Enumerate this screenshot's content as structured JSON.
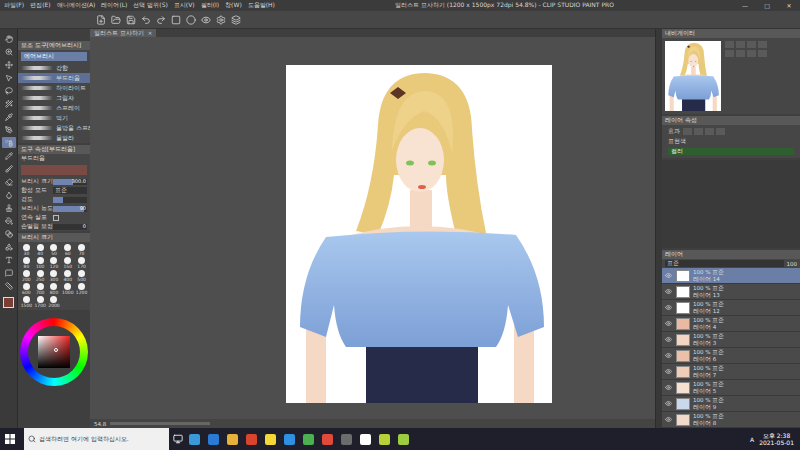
{
  "window": {
    "title": "일러스트 묘사하기 (1200 x 1500px 72dpi 54.8%) - CLIP STUDIO PAINT PRO",
    "menu": [
      "파일(F)",
      "편집(E)",
      "애니메이션(A)",
      "레이어(L)",
      "선택 범위(S)",
      "표시(V)",
      "필터(I)",
      "창(W)",
      "도움말(H)"
    ],
    "controls": [
      "—",
      "□",
      "✕"
    ]
  },
  "document_tab": {
    "label": "일러스트 묘사하기",
    "close": "×"
  },
  "tools": [
    {
      "selected": false
    },
    {
      "selected": false
    },
    {
      "selected": false
    },
    {
      "selected": false
    },
    {
      "selected": false
    },
    {
      "selected": false
    },
    {
      "selected": false
    },
    {
      "selected": false
    },
    {
      "selected": true
    },
    {
      "selected": false
    },
    {
      "selected": false
    },
    {
      "selected": false
    },
    {
      "selected": false
    },
    {
      "selected": false
    },
    {
      "selected": false
    },
    {
      "selected": false
    },
    {
      "selected": false
    },
    {
      "selected": false
    },
    {
      "selected": false
    },
    {
      "selected": false
    }
  ],
  "current_color": "#7b3d34",
  "sub_tool": {
    "title": "보조 도구[에어브러시]",
    "tab": "에어브러시",
    "items": [
      {
        "label": "강함",
        "selected": false
      },
      {
        "label": "부드러움",
        "selected": true
      },
      {
        "label": "하이라이트",
        "selected": false
      },
      {
        "label": "그림자",
        "selected": false
      },
      {
        "label": "스프레이",
        "selected": false
      },
      {
        "label": "먹기",
        "selected": false
      },
      {
        "label": "물방울 스프레이",
        "selected": false
      },
      {
        "label": "물알라",
        "selected": false
      }
    ]
  },
  "tool_property": {
    "title": "도구 속성[부드러움]",
    "tool": "부드러움",
    "rows": [
      {
        "kind": "slider",
        "label": "브러시 크기",
        "value": "300.0",
        "level": 0.6
      },
      {
        "kind": "select",
        "label": "합성 모드",
        "value": "표준"
      },
      {
        "kind": "slider",
        "label": "경도",
        "level": 0.3
      },
      {
        "kind": "slider",
        "label": "브러시 농도",
        "value": "90",
        "level": 0.9
      },
      {
        "kind": "checkbox",
        "label": "연속 살포",
        "checked": false
      },
      {
        "kind": "slider",
        "label": "손떨림 보정",
        "value": "0",
        "level": 0
      }
    ]
  },
  "brush_size": {
    "title": "브러시 크기",
    "sizes": [
      "30",
      "40",
      "50",
      "60",
      "70",
      "80",
      "100",
      "120",
      "150",
      "170",
      "200",
      "250",
      "300",
      "400",
      "500",
      "600",
      "700",
      "800",
      "1000",
      "1200",
      "1500",
      "1700",
      "2000"
    ]
  },
  "color_wheel": {
    "saturation": 0.55,
    "brightness": 0.55
  },
  "canvas_status": {
    "zoom": "54.8"
  },
  "navigator": {
    "title": "내비게이터"
  },
  "layer_property": {
    "title": "레이어 속성",
    "effect_label": "효과",
    "color_label": "표현색",
    "color_value": "컬러"
  },
  "layers": {
    "title": "레이어",
    "blend_mode": "표준",
    "opacity": "100",
    "items": [
      {
        "opacity": "100 %",
        "mode": "표준",
        "name": "레이어 14",
        "visible": true,
        "selected": true,
        "color": "#ffffff"
      },
      {
        "opacity": "100 %",
        "mode": "표준",
        "name": "레이어 13",
        "visible": true,
        "selected": false,
        "color": "#ffffff"
      },
      {
        "opacity": "100 %",
        "mode": "표준",
        "name": "레이어 12",
        "visible": true,
        "selected": false,
        "color": "#ffffff"
      },
      {
        "opacity": "100 %",
        "mode": "표준",
        "name": "레이어 4",
        "visible": true,
        "selected": false,
        "color": "#e9b9a2"
      },
      {
        "opacity": "100 %",
        "mode": "표준",
        "name": "레이어 3",
        "visible": true,
        "selected": false,
        "color": "#f3d5c4"
      },
      {
        "opacity": "100 %",
        "mode": "표준",
        "name": "레이어 6",
        "visible": true,
        "selected": false,
        "color": "#eac0a8"
      },
      {
        "opacity": "100 %",
        "mode": "표준",
        "name": "레이어 7",
        "visible": true,
        "selected": false,
        "color": "#f0cdb8"
      },
      {
        "opacity": "100 %",
        "mode": "표준",
        "name": "레이어 5",
        "visible": true,
        "selected": false,
        "color": "#f6e0d2"
      },
      {
        "opacity": "100 %",
        "mode": "표준",
        "name": "레이어 9",
        "visible": true,
        "selected": false,
        "color": "#c9d8ec"
      },
      {
        "opacity": "100 %",
        "mode": "표준",
        "name": "레이어 8",
        "visible": true,
        "selected": false,
        "color": "#f3d9c9"
      }
    ]
  },
  "taskbar": {
    "search_placeholder": "검색하려면 여기에 입력하십시오.",
    "time": "오후 2:38",
    "date": "2021-05-01",
    "ime": "A",
    "apps": [
      {
        "color": "#3a9ad9"
      },
      {
        "color": "#2a7bd6"
      },
      {
        "color": "#e8b23a"
      },
      {
        "color": "#d9442f"
      },
      {
        "color": "#f5d637"
      },
      {
        "color": "#2f8fe0"
      },
      {
        "color": "#4caf50"
      },
      {
        "color": "#e04a3a"
      },
      {
        "color": "#6c6c6c"
      },
      {
        "color": "#ffffff"
      },
      {
        "color": "#b9d23a"
      },
      {
        "color": "#9ccc40"
      }
    ]
  }
}
